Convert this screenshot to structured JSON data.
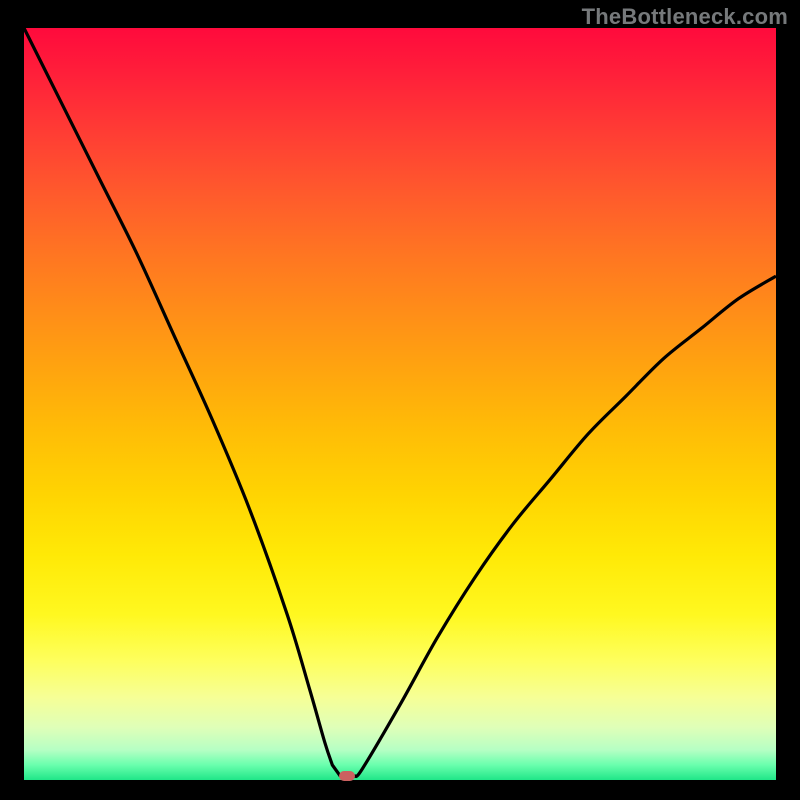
{
  "watermark": "TheBottleneck.com",
  "chart_data": {
    "type": "line",
    "title": "",
    "xlabel": "",
    "ylabel": "",
    "xlim": [
      0,
      100
    ],
    "ylim": [
      0,
      100
    ],
    "grid": false,
    "legend": false,
    "x": [
      0,
      5,
      10,
      15,
      20,
      25,
      30,
      35,
      38,
      40,
      41,
      42,
      43,
      44,
      45,
      50,
      55,
      60,
      65,
      70,
      75,
      80,
      85,
      90,
      95,
      100
    ],
    "values": [
      100,
      90,
      80,
      70,
      59,
      48,
      36,
      22,
      12,
      5,
      2,
      0.6,
      0.5,
      0.5,
      1.5,
      10,
      19,
      27,
      34,
      40,
      46,
      51,
      56,
      60,
      64,
      67
    ],
    "series_name": "bottleneck",
    "optimum_x": 43,
    "optimum_y": 0.5,
    "flat_start_x": 41,
    "flat_end_x": 44
  },
  "colors": {
    "curve": "#000000",
    "marker": "#cb6160",
    "gradient_top": "#ff0a3c",
    "gradient_bottom": "#20e688"
  }
}
